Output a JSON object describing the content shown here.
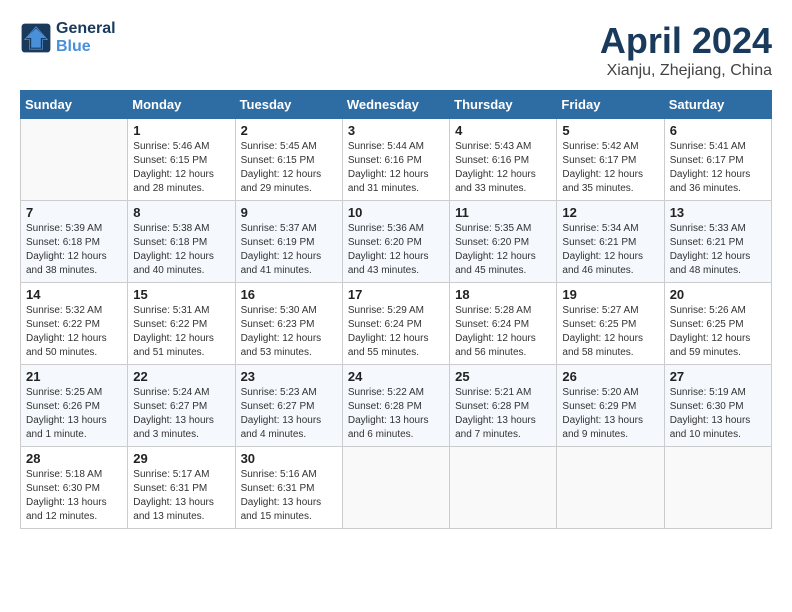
{
  "header": {
    "logo_line1": "General",
    "logo_line2": "Blue",
    "month": "April 2024",
    "location": "Xianju, Zhejiang, China"
  },
  "weekdays": [
    "Sunday",
    "Monday",
    "Tuesday",
    "Wednesday",
    "Thursday",
    "Friday",
    "Saturday"
  ],
  "weeks": [
    [
      {
        "day": "",
        "sunrise": "",
        "sunset": "",
        "daylight": ""
      },
      {
        "day": "1",
        "sunrise": "Sunrise: 5:46 AM",
        "sunset": "Sunset: 6:15 PM",
        "daylight": "Daylight: 12 hours and 28 minutes."
      },
      {
        "day": "2",
        "sunrise": "Sunrise: 5:45 AM",
        "sunset": "Sunset: 6:15 PM",
        "daylight": "Daylight: 12 hours and 29 minutes."
      },
      {
        "day": "3",
        "sunrise": "Sunrise: 5:44 AM",
        "sunset": "Sunset: 6:16 PM",
        "daylight": "Daylight: 12 hours and 31 minutes."
      },
      {
        "day": "4",
        "sunrise": "Sunrise: 5:43 AM",
        "sunset": "Sunset: 6:16 PM",
        "daylight": "Daylight: 12 hours and 33 minutes."
      },
      {
        "day": "5",
        "sunrise": "Sunrise: 5:42 AM",
        "sunset": "Sunset: 6:17 PM",
        "daylight": "Daylight: 12 hours and 35 minutes."
      },
      {
        "day": "6",
        "sunrise": "Sunrise: 5:41 AM",
        "sunset": "Sunset: 6:17 PM",
        "daylight": "Daylight: 12 hours and 36 minutes."
      }
    ],
    [
      {
        "day": "7",
        "sunrise": "Sunrise: 5:39 AM",
        "sunset": "Sunset: 6:18 PM",
        "daylight": "Daylight: 12 hours and 38 minutes."
      },
      {
        "day": "8",
        "sunrise": "Sunrise: 5:38 AM",
        "sunset": "Sunset: 6:18 PM",
        "daylight": "Daylight: 12 hours and 40 minutes."
      },
      {
        "day": "9",
        "sunrise": "Sunrise: 5:37 AM",
        "sunset": "Sunset: 6:19 PM",
        "daylight": "Daylight: 12 hours and 41 minutes."
      },
      {
        "day": "10",
        "sunrise": "Sunrise: 5:36 AM",
        "sunset": "Sunset: 6:20 PM",
        "daylight": "Daylight: 12 hours and 43 minutes."
      },
      {
        "day": "11",
        "sunrise": "Sunrise: 5:35 AM",
        "sunset": "Sunset: 6:20 PM",
        "daylight": "Daylight: 12 hours and 45 minutes."
      },
      {
        "day": "12",
        "sunrise": "Sunrise: 5:34 AM",
        "sunset": "Sunset: 6:21 PM",
        "daylight": "Daylight: 12 hours and 46 minutes."
      },
      {
        "day": "13",
        "sunrise": "Sunrise: 5:33 AM",
        "sunset": "Sunset: 6:21 PM",
        "daylight": "Daylight: 12 hours and 48 minutes."
      }
    ],
    [
      {
        "day": "14",
        "sunrise": "Sunrise: 5:32 AM",
        "sunset": "Sunset: 6:22 PM",
        "daylight": "Daylight: 12 hours and 50 minutes."
      },
      {
        "day": "15",
        "sunrise": "Sunrise: 5:31 AM",
        "sunset": "Sunset: 6:22 PM",
        "daylight": "Daylight: 12 hours and 51 minutes."
      },
      {
        "day": "16",
        "sunrise": "Sunrise: 5:30 AM",
        "sunset": "Sunset: 6:23 PM",
        "daylight": "Daylight: 12 hours and 53 minutes."
      },
      {
        "day": "17",
        "sunrise": "Sunrise: 5:29 AM",
        "sunset": "Sunset: 6:24 PM",
        "daylight": "Daylight: 12 hours and 55 minutes."
      },
      {
        "day": "18",
        "sunrise": "Sunrise: 5:28 AM",
        "sunset": "Sunset: 6:24 PM",
        "daylight": "Daylight: 12 hours and 56 minutes."
      },
      {
        "day": "19",
        "sunrise": "Sunrise: 5:27 AM",
        "sunset": "Sunset: 6:25 PM",
        "daylight": "Daylight: 12 hours and 58 minutes."
      },
      {
        "day": "20",
        "sunrise": "Sunrise: 5:26 AM",
        "sunset": "Sunset: 6:25 PM",
        "daylight": "Daylight: 12 hours and 59 minutes."
      }
    ],
    [
      {
        "day": "21",
        "sunrise": "Sunrise: 5:25 AM",
        "sunset": "Sunset: 6:26 PM",
        "daylight": "Daylight: 13 hours and 1 minute."
      },
      {
        "day": "22",
        "sunrise": "Sunrise: 5:24 AM",
        "sunset": "Sunset: 6:27 PM",
        "daylight": "Daylight: 13 hours and 3 minutes."
      },
      {
        "day": "23",
        "sunrise": "Sunrise: 5:23 AM",
        "sunset": "Sunset: 6:27 PM",
        "daylight": "Daylight: 13 hours and 4 minutes."
      },
      {
        "day": "24",
        "sunrise": "Sunrise: 5:22 AM",
        "sunset": "Sunset: 6:28 PM",
        "daylight": "Daylight: 13 hours and 6 minutes."
      },
      {
        "day": "25",
        "sunrise": "Sunrise: 5:21 AM",
        "sunset": "Sunset: 6:28 PM",
        "daylight": "Daylight: 13 hours and 7 minutes."
      },
      {
        "day": "26",
        "sunrise": "Sunrise: 5:20 AM",
        "sunset": "Sunset: 6:29 PM",
        "daylight": "Daylight: 13 hours and 9 minutes."
      },
      {
        "day": "27",
        "sunrise": "Sunrise: 5:19 AM",
        "sunset": "Sunset: 6:30 PM",
        "daylight": "Daylight: 13 hours and 10 minutes."
      }
    ],
    [
      {
        "day": "28",
        "sunrise": "Sunrise: 5:18 AM",
        "sunset": "Sunset: 6:30 PM",
        "daylight": "Daylight: 13 hours and 12 minutes."
      },
      {
        "day": "29",
        "sunrise": "Sunrise: 5:17 AM",
        "sunset": "Sunset: 6:31 PM",
        "daylight": "Daylight: 13 hours and 13 minutes."
      },
      {
        "day": "30",
        "sunrise": "Sunrise: 5:16 AM",
        "sunset": "Sunset: 6:31 PM",
        "daylight": "Daylight: 13 hours and 15 minutes."
      },
      {
        "day": "",
        "sunrise": "",
        "sunset": "",
        "daylight": ""
      },
      {
        "day": "",
        "sunrise": "",
        "sunset": "",
        "daylight": ""
      },
      {
        "day": "",
        "sunrise": "",
        "sunset": "",
        "daylight": ""
      },
      {
        "day": "",
        "sunrise": "",
        "sunset": "",
        "daylight": ""
      }
    ]
  ]
}
